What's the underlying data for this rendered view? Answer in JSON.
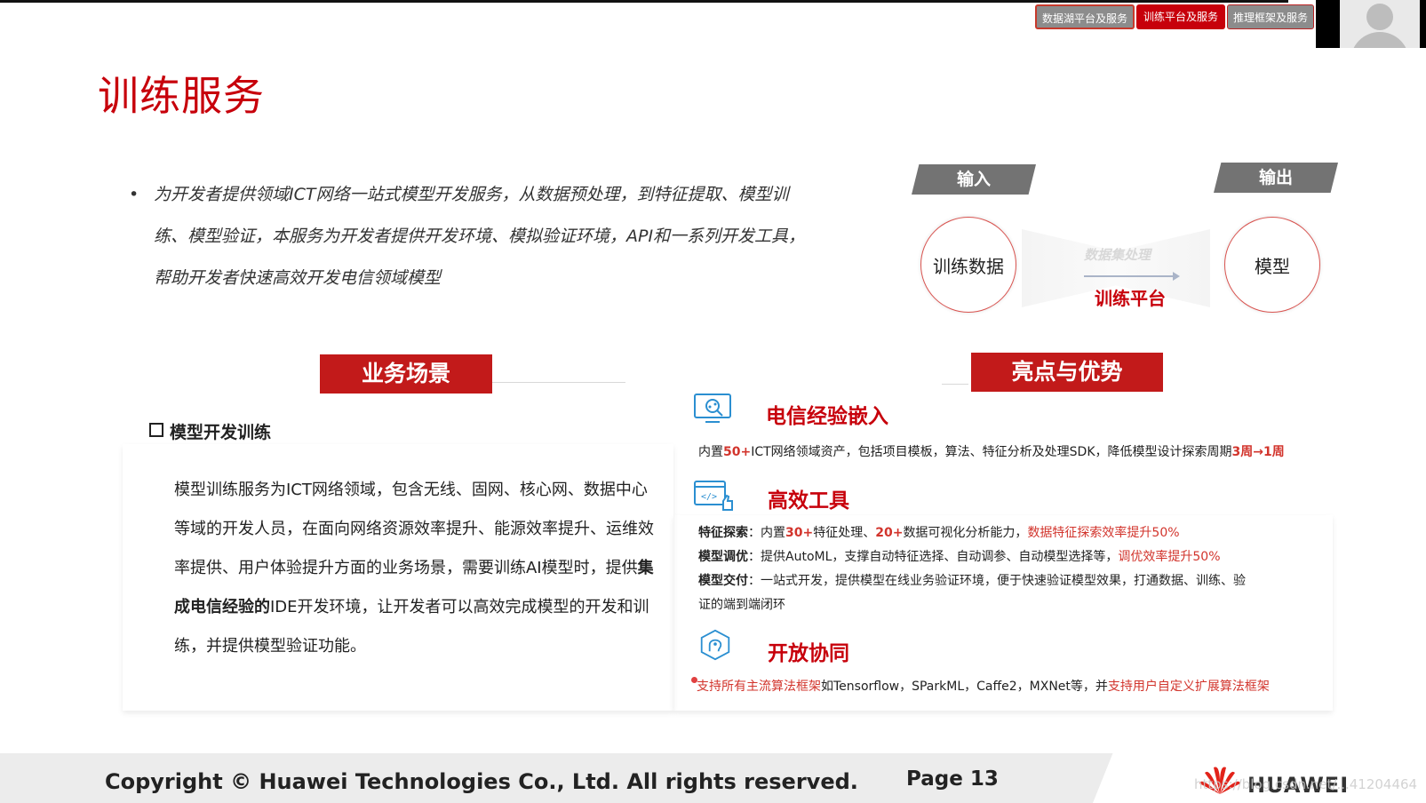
{
  "nav": {
    "tabs": [
      {
        "label": "数据湖平台及服务"
      },
      {
        "label": "训练平台及服务"
      },
      {
        "label": "推理框架及服务"
      }
    ]
  },
  "slide": {
    "title": "训练服务",
    "intro_bullet": "•",
    "intro": "为开发者提供领域ICT网络一站式模型开发服务，从数据预处理，到特征提取、模型训练、模型验证，本服务为开发者提供开发环境、模拟验证环境，API和一系列开发工具，帮助开发者快速高效开发电信领域模型"
  },
  "flow": {
    "input_label": "输入",
    "output_label": "输出",
    "input_item": "训练数据",
    "output_item": "模型",
    "process_sub": "数据集处理",
    "process_main": "训练平台"
  },
  "business": {
    "header": "业务场景",
    "subheader": "模型开发训练",
    "text_a": "模型训练服务为ICT网络领域，包含无线、固网、核心网、数据中心等域的开发人员，在面向网络资源效率提升、能源效率提升、运维效率提供、用户体验提升方面的业务场景，需要训练AI模型时，提供",
    "text_bold": "集成电信经验的",
    "text_b": "IDE开发环境，让开发者可以高效完成模型的开发和训练，并提供模型验证功能。"
  },
  "advantages": {
    "header": "亮点与优势",
    "feature1": {
      "icon": "search-analytics-icon",
      "title": "电信经验嵌入",
      "d1": "内置",
      "d2": "50+",
      "d3": "ICT网络领域资产，包括项目模板，算法、特征分析及处理SDK，降低模型设计探索周期",
      "d4": "3周→1周"
    },
    "feature2": {
      "icon": "code-thumbs-up-icon",
      "title": "高效工具",
      "l1_label": "特征探索",
      "l1_a": "：内置",
      "l1_b": "30+",
      "l1_c": "特征处理、",
      "l1_d": "20+",
      "l1_e": "数据可视化分析能力，",
      "l1_f": "数据特征探索效率提升50%",
      "l2_label": "模型调优",
      "l2_a": "：提供AutoML，支撑自动特征选择、自动调参、自动模型选择等，",
      "l2_b": "调优效率提升50%",
      "l3_label": "模型交付",
      "l3_a": "：一站式开发，提供模型在线业务验证环境，便于快速验证模型效果，打通数据、训练、验",
      "l3_b": "证的端到端闭环"
    },
    "feature3": {
      "icon": "brain-hexagon-icon",
      "title": "开放协同",
      "d1": "支持所有主流算法框架",
      "d2": "如Tensorflow，SParkML，Caffe2，MXNet等，并",
      "d3": "支持用户自定义扩展算法框架"
    }
  },
  "footer": {
    "copyright": "Copyright © Huawei Technologies Co., Ltd. All rights reserved.",
    "page": "Page 13",
    "brand": "HUAWEI",
    "watermark": "https://blog.csdn.net/...41204464"
  },
  "colors": {
    "accent": "#c7000b",
    "tab_active": "#c7000b",
    "tab_inactive": "#8c8c8c"
  }
}
